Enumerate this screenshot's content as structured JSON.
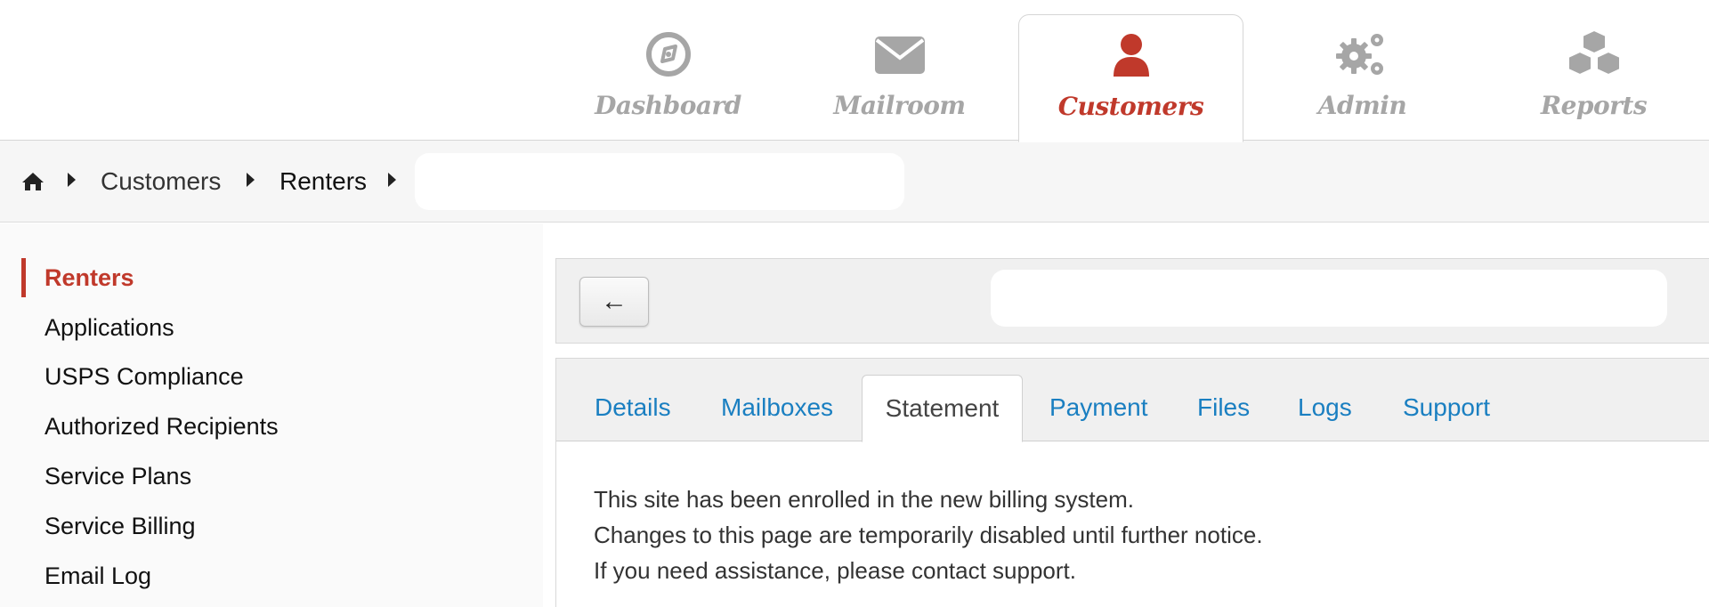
{
  "top_nav": {
    "items": [
      {
        "label": "Dashboard",
        "icon": "compass-icon",
        "active": false
      },
      {
        "label": "Mailroom",
        "icon": "envelope-icon",
        "active": false
      },
      {
        "label": "Customers",
        "icon": "user-icon",
        "active": true
      },
      {
        "label": "Admin",
        "icon": "gears-icon",
        "active": false
      },
      {
        "label": "Reports",
        "icon": "cubes-icon",
        "active": false
      }
    ],
    "active_color": "#c0392b",
    "inactive_color": "#a6a6a6"
  },
  "breadcrumb": {
    "home_icon": "home-icon",
    "items": [
      "Customers",
      "Renters"
    ],
    "search_value": ""
  },
  "sidebar": {
    "items": [
      {
        "label": "Renters",
        "active": true
      },
      {
        "label": "Applications",
        "active": false
      },
      {
        "label": "USPS Compliance",
        "active": false
      },
      {
        "label": "Authorized Recipients",
        "active": false
      },
      {
        "label": "Service Plans",
        "active": false
      },
      {
        "label": "Service Billing",
        "active": false
      },
      {
        "label": "Email Log",
        "active": false
      }
    ]
  },
  "toolbar": {
    "back_label": "←",
    "search_value": ""
  },
  "tabs": {
    "items": [
      {
        "label": "Details",
        "active": false
      },
      {
        "label": "Mailboxes",
        "active": false
      },
      {
        "label": "Statement",
        "active": true
      },
      {
        "label": "Payment",
        "active": false
      },
      {
        "label": "Files",
        "active": false
      },
      {
        "label": "Logs",
        "active": false
      },
      {
        "label": "Support",
        "active": false
      }
    ],
    "link_color": "#1a7fc1"
  },
  "notice": {
    "lines": [
      "This site has been enrolled in the new billing system.",
      "Changes to this page are temporarily disabled until further notice.",
      "If you need assistance, please contact support."
    ]
  }
}
